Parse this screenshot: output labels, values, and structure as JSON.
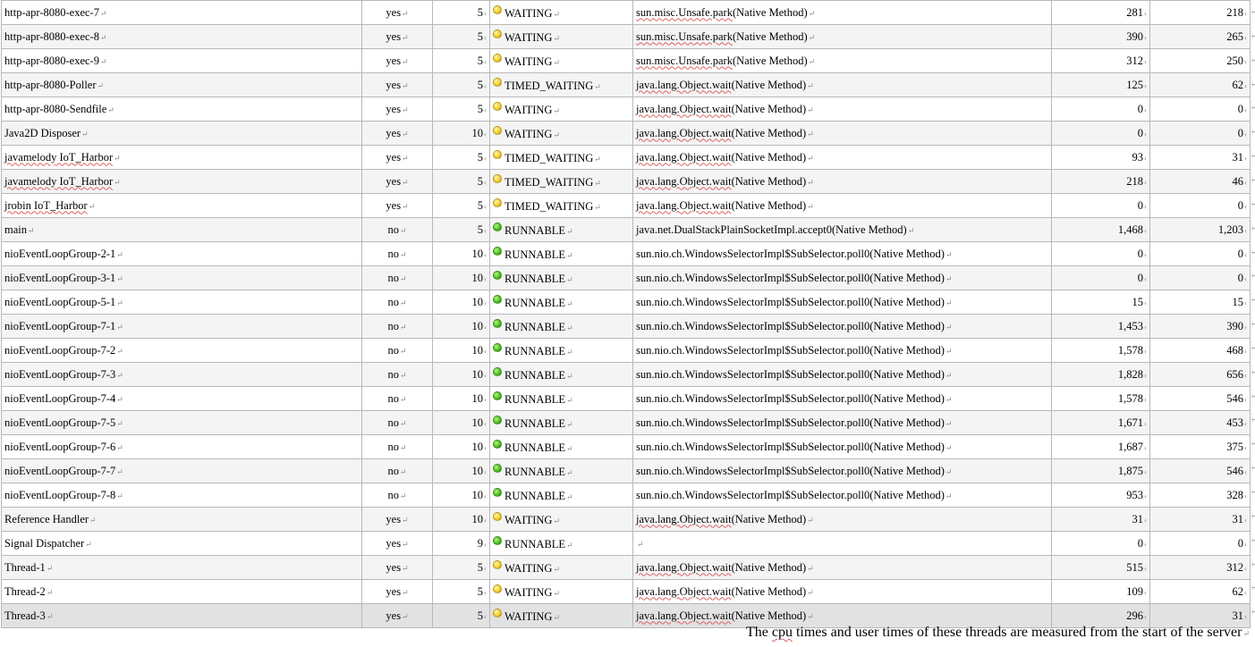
{
  "rows": [
    {
      "name": "http-apr-8080-exec-7",
      "daemon": "yes",
      "priority": "5",
      "state": "WAITING",
      "state_color": "yellow",
      "method_pre": "",
      "method_link": "sun.misc.Unsafe.park",
      "method_post": "(Native Method)",
      "cpu": "281",
      "user": "218"
    },
    {
      "name": "http-apr-8080-exec-8",
      "daemon": "yes",
      "priority": "5",
      "state": "WAITING",
      "state_color": "yellow",
      "method_pre": "",
      "method_link": "sun.misc.Unsafe.park",
      "method_post": "(Native Method)",
      "cpu": "390",
      "user": "265"
    },
    {
      "name": "http-apr-8080-exec-9",
      "daemon": "yes",
      "priority": "5",
      "state": "WAITING",
      "state_color": "yellow",
      "method_pre": "",
      "method_link": "sun.misc.Unsafe.park",
      "method_post": "(Native Method)",
      "cpu": "312",
      "user": "250"
    },
    {
      "name": "http-apr-8080-Poller",
      "daemon": "yes",
      "priority": "5",
      "state": "TIMED_WAITING",
      "state_color": "yellow",
      "method_pre": "",
      "method_link": "java.lang.Object.wait",
      "method_post": "(Native Method)",
      "cpu": "125",
      "user": "62"
    },
    {
      "name": "http-apr-8080-Sendfile",
      "daemon": "yes",
      "priority": "5",
      "state": "WAITING",
      "state_color": "yellow",
      "method_pre": "",
      "method_link": "java.lang.Object.wait",
      "method_post": "(Native Method)",
      "cpu": "0",
      "user": "0"
    },
    {
      "name": "Java2D Disposer",
      "daemon": "yes",
      "priority": "10",
      "state": "WAITING",
      "state_color": "yellow",
      "method_pre": "",
      "method_link": "java.lang.Object.wait",
      "method_post": "(Native Method)",
      "cpu": "0",
      "user": "0"
    },
    {
      "name": "javamelody IoT_Harbor",
      "daemon": "yes",
      "priority": "5",
      "state": "TIMED_WAITING",
      "state_color": "yellow",
      "method_pre": "",
      "method_link": "java.lang.Object.wait",
      "method_post": "(Native Method)",
      "cpu": "93",
      "user": "31"
    },
    {
      "name": "javamelody IoT_Harbor",
      "daemon": "yes",
      "priority": "5",
      "state": "TIMED_WAITING",
      "state_color": "yellow",
      "method_pre": "",
      "method_link": "java.lang.Object.wait",
      "method_post": "(Native Method)",
      "cpu": "218",
      "user": "46"
    },
    {
      "name": "jrobin  IoT_Harbor",
      "daemon": "yes",
      "priority": "5",
      "state": "TIMED_WAITING",
      "state_color": "yellow",
      "method_pre": "",
      "method_link": "java.lang.Object.wait",
      "method_post": "(Native Method)",
      "cpu": "0",
      "user": "0"
    },
    {
      "name": "main",
      "daemon": "no",
      "priority": "5",
      "state": "RUNNABLE",
      "state_color": "green",
      "method_pre": "java.net.DualStackPlainSocketImpl.accept0(Native Method)",
      "method_link": "",
      "method_post": "",
      "cpu": "1,468",
      "user": "1,203"
    },
    {
      "name": "nioEventLoopGroup-2-1",
      "daemon": "no",
      "priority": "10",
      "state": "RUNNABLE",
      "state_color": "green",
      "method_pre": "sun.nio.ch.WindowsSelectorImpl$SubSelector.poll0(Native Method)",
      "method_link": "",
      "method_post": "",
      "cpu": "0",
      "user": "0"
    },
    {
      "name": "nioEventLoopGroup-3-1",
      "daemon": "no",
      "priority": "10",
      "state": "RUNNABLE",
      "state_color": "green",
      "method_pre": "sun.nio.ch.WindowsSelectorImpl$SubSelector.poll0(Native Method)",
      "method_link": "",
      "method_post": "",
      "cpu": "0",
      "user": "0"
    },
    {
      "name": "nioEventLoopGroup-5-1",
      "daemon": "no",
      "priority": "10",
      "state": "RUNNABLE",
      "state_color": "green",
      "method_pre": "sun.nio.ch.WindowsSelectorImpl$SubSelector.poll0(Native Method)",
      "method_link": "",
      "method_post": "",
      "cpu": "15",
      "user": "15"
    },
    {
      "name": "nioEventLoopGroup-7-1",
      "daemon": "no",
      "priority": "10",
      "state": "RUNNABLE",
      "state_color": "green",
      "method_pre": "sun.nio.ch.WindowsSelectorImpl$SubSelector.poll0(Native Method)",
      "method_link": "",
      "method_post": "",
      "cpu": "1,453",
      "user": "390"
    },
    {
      "name": "nioEventLoopGroup-7-2",
      "daemon": "no",
      "priority": "10",
      "state": "RUNNABLE",
      "state_color": "green",
      "method_pre": "sun.nio.ch.WindowsSelectorImpl$SubSelector.poll0(Native Method)",
      "method_link": "",
      "method_post": "",
      "cpu": "1,578",
      "user": "468"
    },
    {
      "name": "nioEventLoopGroup-7-3",
      "daemon": "no",
      "priority": "10",
      "state": "RUNNABLE",
      "state_color": "green",
      "method_pre": "sun.nio.ch.WindowsSelectorImpl$SubSelector.poll0(Native Method)",
      "method_link": "",
      "method_post": "",
      "cpu": "1,828",
      "user": "656"
    },
    {
      "name": "nioEventLoopGroup-7-4",
      "daemon": "no",
      "priority": "10",
      "state": "RUNNABLE",
      "state_color": "green",
      "method_pre": "sun.nio.ch.WindowsSelectorImpl$SubSelector.poll0(Native Method)",
      "method_link": "",
      "method_post": "",
      "cpu": "1,578",
      "user": "546"
    },
    {
      "name": "nioEventLoopGroup-7-5",
      "daemon": "no",
      "priority": "10",
      "state": "RUNNABLE",
      "state_color": "green",
      "method_pre": "sun.nio.ch.WindowsSelectorImpl$SubSelector.poll0(Native Method)",
      "method_link": "",
      "method_post": "",
      "cpu": "1,671",
      "user": "453"
    },
    {
      "name": "nioEventLoopGroup-7-6",
      "daemon": "no",
      "priority": "10",
      "state": "RUNNABLE",
      "state_color": "green",
      "method_pre": "sun.nio.ch.WindowsSelectorImpl$SubSelector.poll0(Native Method)",
      "method_link": "",
      "method_post": "",
      "cpu": "1,687",
      "user": "375"
    },
    {
      "name": "nioEventLoopGroup-7-7",
      "daemon": "no",
      "priority": "10",
      "state": "RUNNABLE",
      "state_color": "green",
      "method_pre": "sun.nio.ch.WindowsSelectorImpl$SubSelector.poll0(Native Method)",
      "method_link": "",
      "method_post": "",
      "cpu": "1,875",
      "user": "546"
    },
    {
      "name": "nioEventLoopGroup-7-8",
      "daemon": "no",
      "priority": "10",
      "state": "RUNNABLE",
      "state_color": "green",
      "method_pre": "sun.nio.ch.WindowsSelectorImpl$SubSelector.poll0(Native Method)",
      "method_link": "",
      "method_post": "",
      "cpu": "953",
      "user": "328"
    },
    {
      "name": "Reference Handler",
      "daemon": "yes",
      "priority": "10",
      "state": "WAITING",
      "state_color": "yellow",
      "method_pre": "",
      "method_link": "java.lang.Object.wait",
      "method_post": "(Native Method)",
      "cpu": "31",
      "user": "31"
    },
    {
      "name": "Signal Dispatcher",
      "daemon": "yes",
      "priority": "9",
      "state": "RUNNABLE",
      "state_color": "green",
      "method_pre": "",
      "method_link": "",
      "method_post": "",
      "cpu": "0",
      "user": "0"
    },
    {
      "name": "Thread-1",
      "daemon": "yes",
      "priority": "5",
      "state": "WAITING",
      "state_color": "yellow",
      "method_pre": "",
      "method_link": "java.lang.Object.wait",
      "method_post": "(Native Method)",
      "cpu": "515",
      "user": "312"
    },
    {
      "name": "Thread-2",
      "daemon": "yes",
      "priority": "5",
      "state": "WAITING",
      "state_color": "yellow",
      "method_pre": "",
      "method_link": "java.lang.Object.wait",
      "method_post": "(Native Method)",
      "cpu": "109",
      "user": "62"
    },
    {
      "name": "Thread-3",
      "daemon": "yes",
      "priority": "5",
      "state": "WAITING",
      "state_color": "yellow",
      "method_pre": "",
      "method_link": "java.lang.Object.wait",
      "method_post": "(Native Method)",
      "cpu": "296",
      "user": "31"
    }
  ],
  "footer": {
    "note_pre": "The ",
    "note_cpu": "cpu",
    "note_post": " times and user times of these threads are measured from the start of the server"
  },
  "colors": {
    "green": "#4cc21f",
    "yellow": "#f5cf2a",
    "spellcheck": "#e06060"
  },
  "glyphs": {
    "paragraph_mark": "↵",
    "cell_mark": "‹"
  }
}
